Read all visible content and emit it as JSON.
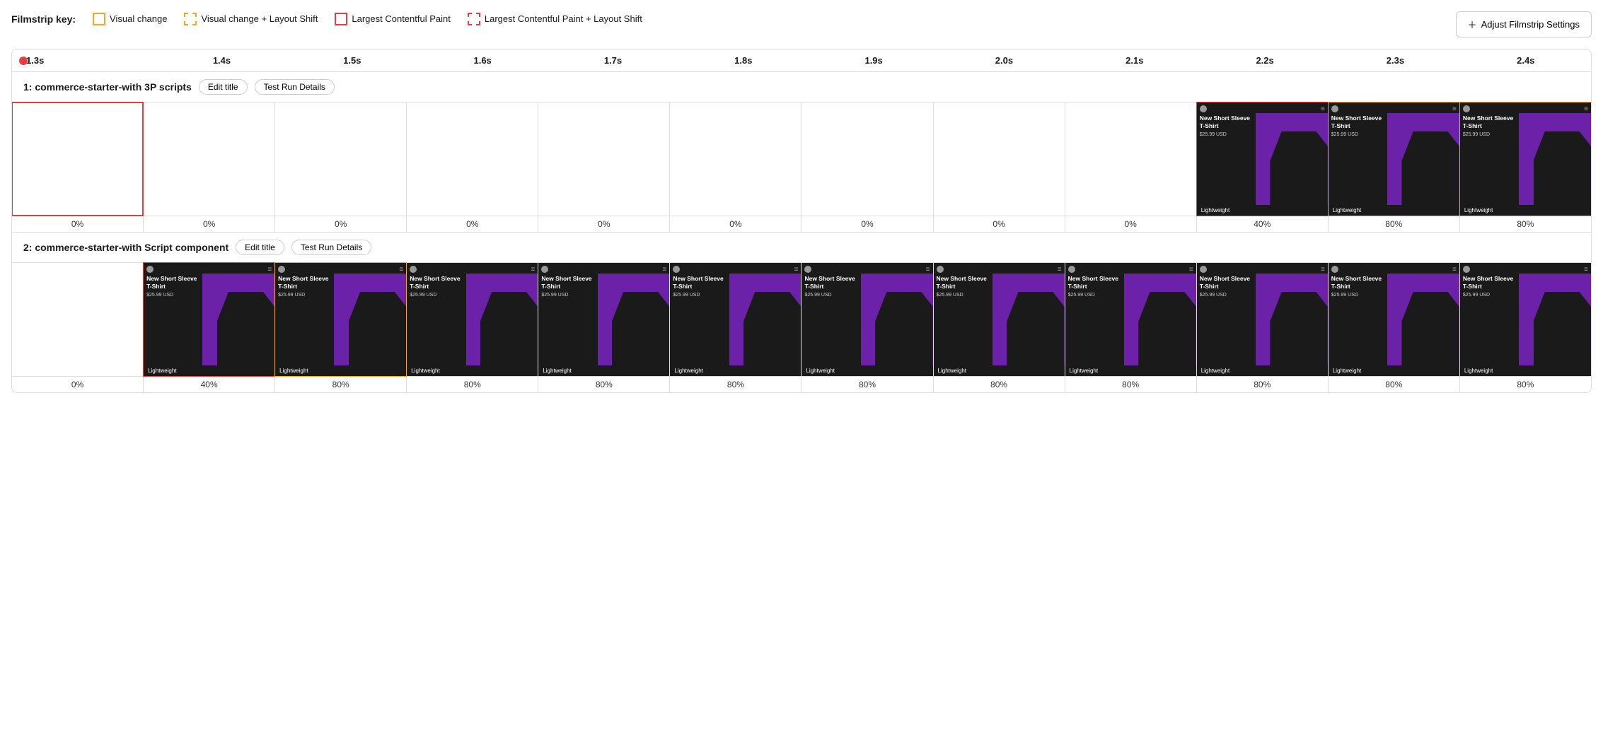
{
  "legend": {
    "label": "Filmstrip key:",
    "items": [
      {
        "id": "visual-change",
        "label": "Visual change",
        "style": "visual-change"
      },
      {
        "id": "visual-change-layout",
        "label": "Visual change + Layout Shift",
        "style": "visual-change-layout"
      },
      {
        "id": "lcp",
        "label": "Largest Contentful Paint",
        "style": "lcp"
      },
      {
        "id": "lcp-layout",
        "label": "Largest Contentful Paint + Layout Shift",
        "style": "lcp-layout"
      }
    ]
  },
  "adjust_btn": "Adjust Filmstrip Settings",
  "timeline": {
    "ticks": [
      "1.3s",
      "1.4s",
      "1.5s",
      "1.6s",
      "1.7s",
      "1.8s",
      "1.9s",
      "2.0s",
      "2.1s",
      "2.2s",
      "2.3s",
      "2.4s"
    ]
  },
  "runs": [
    {
      "id": "run1",
      "title": "1: commerce-starter-with 3P scripts",
      "edit_label": "Edit title",
      "details_label": "Test Run Details",
      "frames": [
        {
          "border": "red",
          "empty": true,
          "pct": "0%"
        },
        {
          "border": null,
          "empty": true,
          "pct": "0%"
        },
        {
          "border": null,
          "empty": true,
          "pct": "0%"
        },
        {
          "border": null,
          "empty": true,
          "pct": "0%"
        },
        {
          "border": null,
          "empty": true,
          "pct": "0%"
        },
        {
          "border": null,
          "empty": true,
          "pct": "0%"
        },
        {
          "border": null,
          "empty": true,
          "pct": "0%"
        },
        {
          "border": null,
          "empty": true,
          "pct": "0%"
        },
        {
          "border": null,
          "empty": true,
          "pct": "0%"
        },
        {
          "border": "red",
          "empty": false,
          "pct": "40%"
        },
        {
          "border": "yellow",
          "empty": false,
          "pct": "80%"
        },
        {
          "border": "yellow",
          "empty": false,
          "pct": "80%"
        }
      ]
    },
    {
      "id": "run2",
      "title": "2: commerce-starter-with Script component",
      "edit_label": "Edit title",
      "details_label": "Test Run Details",
      "frames": [
        {
          "border": null,
          "empty": true,
          "pct": "0%"
        },
        {
          "border": "red",
          "empty": false,
          "pct": "40%"
        },
        {
          "border": "yellow",
          "empty": false,
          "pct": "80%"
        },
        {
          "border": null,
          "empty": false,
          "pct": "80%"
        },
        {
          "border": null,
          "empty": false,
          "pct": "80%"
        },
        {
          "border": null,
          "empty": false,
          "pct": "80%"
        },
        {
          "border": null,
          "empty": false,
          "pct": "80%"
        },
        {
          "border": null,
          "empty": false,
          "pct": "80%"
        },
        {
          "border": null,
          "empty": false,
          "pct": "80%"
        },
        {
          "border": null,
          "empty": false,
          "pct": "80%"
        },
        {
          "border": null,
          "empty": false,
          "pct": "80%"
        },
        {
          "border": null,
          "empty": false,
          "pct": "80%"
        }
      ]
    }
  ],
  "product": {
    "title": "New Short Sleeve T-Shirt",
    "price": "$25.99 USD",
    "footer": "Lightweight"
  }
}
